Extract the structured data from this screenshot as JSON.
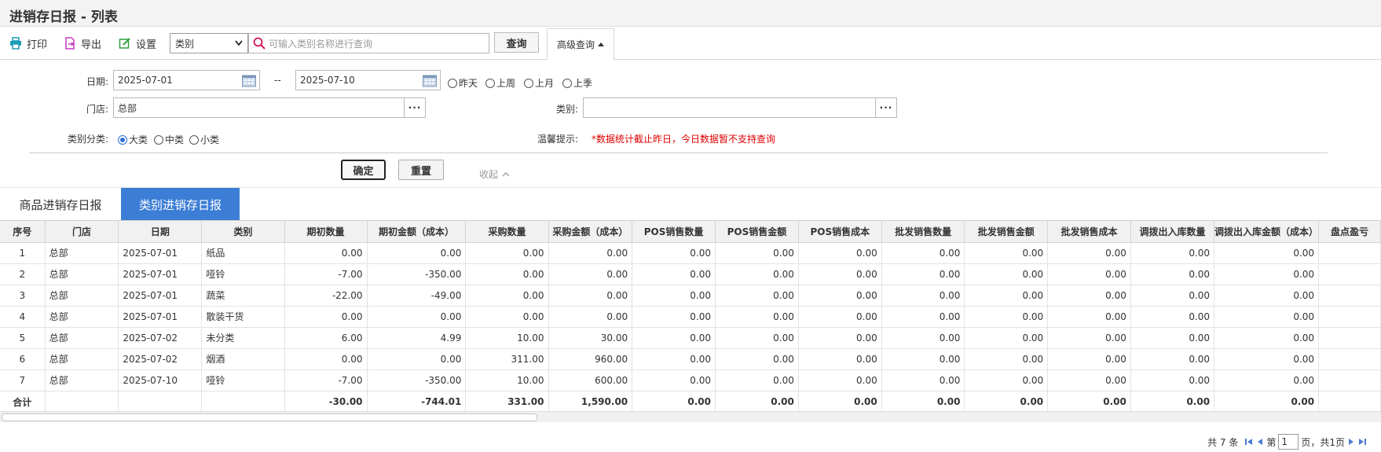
{
  "title": "进销存日报 - 列表",
  "toolbar": {
    "print_label": "打印",
    "export_label": "导出",
    "settings_label": "设置",
    "select_value": "类别",
    "search_placeholder": "可输入类别名称进行查询",
    "query_label": "查询",
    "advanced_label": "高级查询"
  },
  "form": {
    "date_label": "日期:",
    "date_from": "2025-07-01",
    "date_sep": "--",
    "date_to": "2025-07-10",
    "quick_dates": [
      "昨天",
      "上周",
      "上月",
      "上季"
    ],
    "store_label": "门店:",
    "store_value": "总部",
    "category_label": "类别:",
    "category_value": "",
    "class_label": "类别分类:",
    "class_options": [
      "大类",
      "中类",
      "小类"
    ],
    "hint_label": "温馨提示:",
    "hint_text": "*数据统计截止昨日，今日数据暂不支持查询",
    "confirm_label": "确定",
    "reset_label": "重置",
    "collapse_label": "收起"
  },
  "tabs": [
    "商品进销存日报",
    "类别进销存日报"
  ],
  "table": {
    "columns": [
      "序号",
      "门店",
      "日期",
      "类别",
      "期初数量",
      "期初金额（成本）",
      "采购数量",
      "采购金额（成本）",
      "POS销售数量",
      "POS销售金额",
      "POS销售成本",
      "批发销售数量",
      "批发销售金额",
      "批发销售成本",
      "调拨出入库数量",
      "调拨出入库金额（成本）",
      "盘点盈亏"
    ],
    "rows": [
      [
        "1",
        "总部",
        "2025-07-01",
        "纸品",
        "0.00",
        "0.00",
        "0.00",
        "0.00",
        "0.00",
        "0.00",
        "0.00",
        "0.00",
        "0.00",
        "0.00",
        "0.00",
        "0.00",
        ""
      ],
      [
        "2",
        "总部",
        "2025-07-01",
        "哑铃",
        "-7.00",
        "-350.00",
        "0.00",
        "0.00",
        "0.00",
        "0.00",
        "0.00",
        "0.00",
        "0.00",
        "0.00",
        "0.00",
        "0.00",
        ""
      ],
      [
        "3",
        "总部",
        "2025-07-01",
        "蔬菜",
        "-22.00",
        "-49.00",
        "0.00",
        "0.00",
        "0.00",
        "0.00",
        "0.00",
        "0.00",
        "0.00",
        "0.00",
        "0.00",
        "0.00",
        ""
      ],
      [
        "4",
        "总部",
        "2025-07-01",
        "散装干货",
        "0.00",
        "0.00",
        "0.00",
        "0.00",
        "0.00",
        "0.00",
        "0.00",
        "0.00",
        "0.00",
        "0.00",
        "0.00",
        "0.00",
        ""
      ],
      [
        "5",
        "总部",
        "2025-07-02",
        "未分类",
        "6.00",
        "4.99",
        "10.00",
        "30.00",
        "0.00",
        "0.00",
        "0.00",
        "0.00",
        "0.00",
        "0.00",
        "0.00",
        "0.00",
        ""
      ],
      [
        "6",
        "总部",
        "2025-07-02",
        "烟酒",
        "0.00",
        "0.00",
        "311.00",
        "960.00",
        "0.00",
        "0.00",
        "0.00",
        "0.00",
        "0.00",
        "0.00",
        "0.00",
        "0.00",
        ""
      ],
      [
        "7",
        "总部",
        "2025-07-10",
        "哑铃",
        "-7.00",
        "-350.00",
        "10.00",
        "600.00",
        "0.00",
        "0.00",
        "0.00",
        "0.00",
        "0.00",
        "0.00",
        "0.00",
        "0.00",
        ""
      ]
    ],
    "total": [
      "合计",
      "",
      "",
      "",
      "-30.00",
      "-744.01",
      "331.00",
      "1,590.00",
      "0.00",
      "0.00",
      "0.00",
      "0.00",
      "0.00",
      "0.00",
      "0.00",
      "0.00",
      ""
    ]
  },
  "pager": {
    "total_text": "共 7 条",
    "page_prefix": "第",
    "page_value": "1",
    "page_suffix": "页，共1页"
  }
}
